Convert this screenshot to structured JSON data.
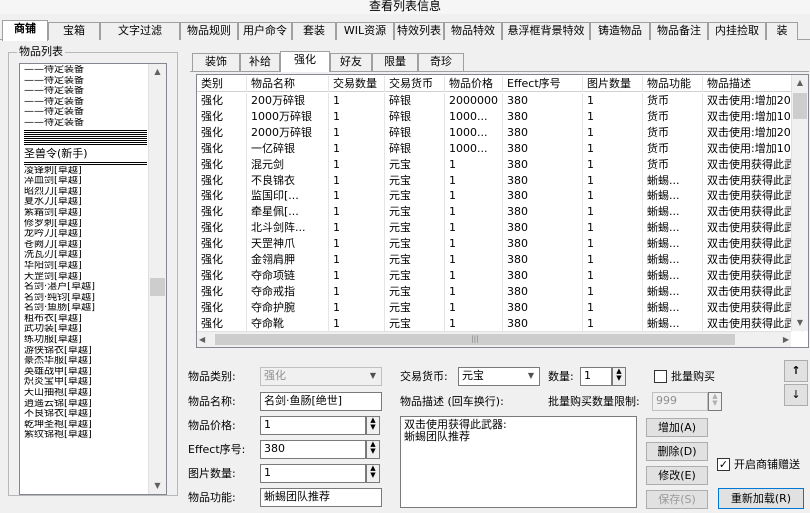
{
  "window": {
    "title": "查看列表信息"
  },
  "tabs": [
    "商铺",
    "宝箱",
    "文字过滤",
    "物品规则",
    "用户命令",
    "套装",
    "WIL资源",
    "特效列表",
    "物品特效",
    "悬浮框背景特效",
    "铸造物品",
    "物品备注",
    "内挂捡取",
    "装"
  ],
  "active_tab": 0,
  "item_list": {
    "title": "物品列表",
    "items": [
      "——待定装备",
      "——待定装备",
      "——待定装备",
      "——待定装备",
      "——待定装备",
      "——待定装备",
      "—",
      "—",
      "—",
      "—",
      "圣兽令(新手)",
      "—",
      "凌锋刺[卓越]",
      "淬血剑[卓越]",
      "昭烈刀[卓越]",
      "夏水刀[卓越]",
      "紫霜剑[卓越]",
      "修罗刺[卓越]",
      "龙吟刀[卓越]",
      "苍阙刀[卓越]",
      "洗瓦刃[卓越]",
      "华阳剑[卓越]",
      "天罡剑[卓越]",
      "名剑·湛卢[卓越]",
      "名剑·纯钧[卓越]",
      "名剑·鱼肠[卓越]",
      "粗布衣[卓越]",
      "武功装[卓越]",
      "练功服[卓越]",
      "游侠锦衣[卓越]",
      "豪杰华服[卓越]",
      "英雄战甲[卓越]",
      "炽炎宝甲[卓越]",
      "天山抽袍[卓越]",
      "逍遥云锦[卓越]",
      "不良锦衣[卓越]",
      "乾坤圣袍[卓越]",
      "紫纹锦袍[卓越]"
    ]
  },
  "sub_tabs": [
    "装饰",
    "补给",
    "强化",
    "好友",
    "限量",
    "奇珍"
  ],
  "active_sub_tab": 2,
  "table": {
    "columns": [
      "类别",
      "物品名称",
      "交易数量",
      "交易货币",
      "物品价格",
      "Effect序号",
      "图片数量",
      "物品功能",
      "物品描述"
    ],
    "rows": [
      [
        "强化",
        "200万碎银",
        "1",
        "碎银",
        "2000000",
        "380",
        "1",
        "货币",
        "双击使用:增加20"
      ],
      [
        "强化",
        "1000万碎银",
        "1",
        "碎银",
        "1000...",
        "380",
        "1",
        "货币",
        "双击使用:增加10"
      ],
      [
        "强化",
        "2000万碎银",
        "1",
        "碎银",
        "1000...",
        "380",
        "1",
        "货币",
        "双击使用:增加20"
      ],
      [
        "强化",
        "一亿碎银",
        "1",
        "碎银",
        "1000...",
        "380",
        "1",
        "货币",
        "双击使用:增加10"
      ],
      [
        "强化",
        "混元剑",
        "1",
        "元宝",
        "1",
        "380",
        "1",
        "货币",
        "双击使用获得此武"
      ],
      [
        "强化",
        "不良锦衣",
        "1",
        "元宝",
        "1",
        "380",
        "1",
        "蜥蜴...",
        "双击使用获得此武"
      ],
      [
        "强化",
        "监国印[...",
        "1",
        "元宝",
        "1",
        "380",
        "1",
        "蜥蜴...",
        "双击使用获得此武"
      ],
      [
        "强化",
        "牵星佩[...",
        "1",
        "元宝",
        "1",
        "380",
        "1",
        "蜥蜴...",
        "双击使用获得此武"
      ],
      [
        "强化",
        "北斗剑阵...",
        "1",
        "元宝",
        "1",
        "380",
        "1",
        "蜥蜴...",
        "双击使用获得此武"
      ],
      [
        "强化",
        "天罡神爪",
        "1",
        "元宝",
        "1",
        "380",
        "1",
        "蜥蜴...",
        "双击使用获得此武"
      ],
      [
        "强化",
        "金翎肩胛",
        "1",
        "元宝",
        "1",
        "380",
        "1",
        "蜥蜴...",
        "双击使用获得此武"
      ],
      [
        "强化",
        "夺命项链",
        "1",
        "元宝",
        "1",
        "380",
        "1",
        "蜥蜴...",
        "双击使用获得此武"
      ],
      [
        "强化",
        "夺命戒指",
        "1",
        "元宝",
        "1",
        "380",
        "1",
        "蜥蜴...",
        "双击使用获得此武"
      ],
      [
        "强化",
        "夺命护腕",
        "1",
        "元宝",
        "1",
        "380",
        "1",
        "蜥蜴...",
        "双击使用获得此武"
      ],
      [
        "强化",
        "夺命靴",
        "1",
        "元宝",
        "1",
        "380",
        "1",
        "蜥蜴...",
        "双击使用获得此武"
      ]
    ]
  },
  "form": {
    "category_label": "物品类别:",
    "category_value": "强化",
    "name_label": "物品名称:",
    "name_value": "名剑·鱼肠[绝世]",
    "price_label": "物品价格:",
    "price_value": "1",
    "effect_label": "Effect序号:",
    "effect_value": "380",
    "image_label": "图片数量:",
    "image_value": "1",
    "function_label": "物品功能:",
    "function_value": "蜥蜴团队推荐",
    "currency_label": "交易货币:",
    "currency_value": "元宝",
    "quantity_label": "数量:",
    "quantity_value": "1",
    "bulk_label": "批量购买",
    "desc_label": "物品描述 (回车换行):",
    "bulk_limit_label": "批量购买数量限制:",
    "bulk_limit_value": "999",
    "desc_lines": [
      "双击使用获得此武器:",
      "蜥蜴团队推荐"
    ],
    "gift_label": "开启商铺赠送"
  },
  "buttons": {
    "add": "增加(A)",
    "delete": "删除(D)",
    "modify": "修改(E)",
    "save": "保存(S)",
    "reload": "重新加载(R)",
    "up": "↑",
    "down": "↓"
  }
}
